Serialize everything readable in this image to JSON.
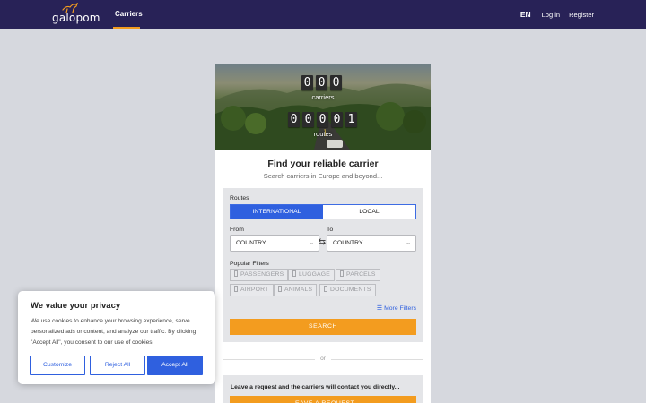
{
  "nav": {
    "logo_text": "galopom",
    "carriers": "Carriers",
    "language": "EN",
    "login": "Log in",
    "register": "Register"
  },
  "hero": {
    "carriers_digits": [
      "0",
      "0",
      "0"
    ],
    "carriers_label": "carriers",
    "routes_digits": [
      "0",
      "0",
      "0",
      "0",
      "1"
    ],
    "routes_label": "routes"
  },
  "search": {
    "title": "Find your reliable carrier",
    "subtitle": "Search carriers in Europe and beyond...",
    "routes_label": "Routes",
    "tab_international": "INTERNATIONAL",
    "tab_local": "LOCAL",
    "from_label": "From",
    "to_label": "To",
    "from_value": "COUNTRY",
    "to_value": "COUNTRY",
    "popular_filters_label": "Popular Filters",
    "filters": [
      "PASSENGERS",
      "LUGGAGE",
      "PARCELS",
      "AIRPORT",
      "ANIMALS",
      "DOCUMENTS"
    ],
    "more_filters": "More Filters",
    "search_button": "SEARCH"
  },
  "or_text": "or",
  "request": {
    "text": "Leave a request and the carriers will contact you directly...",
    "button": "LEAVE A REQUEST"
  },
  "cookie": {
    "title": "We value your privacy",
    "text": "We use cookies to enhance your browsing experience, serve personalized ads or content, and analyze our traffic. By clicking \"Accept All\", you consent to our use of cookies.",
    "customize": "Customize",
    "reject": "Reject All",
    "accept": "Accept All"
  },
  "colors": {
    "nav_bg": "#282257",
    "accent_orange": "#f39c1f",
    "primary_blue": "#2f60df",
    "page_bg": "#d6d8de"
  }
}
